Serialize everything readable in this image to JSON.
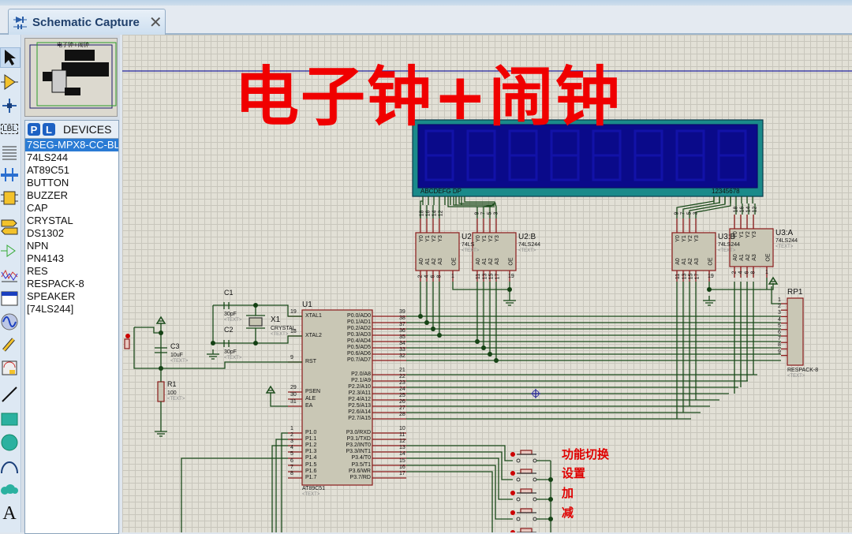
{
  "tab": {
    "label": "Schematic Capture",
    "close": "✕"
  },
  "toolbar": {
    "tools": [
      "selection-mode",
      "component-mode",
      "junction-dot-mode",
      "wire-label-mode",
      "text-script-mode",
      "buses-mode",
      "subcircuit-mode",
      "terminals-mode",
      "device-pins-mode",
      "graph-mode",
      "tape-recorder-mode",
      "generator-mode",
      "voltage-probe-mode",
      "virtual-instruments-mode",
      "line-mode",
      "box-mode",
      "circle-mode",
      "arc-mode",
      "path-mode",
      "text-mode"
    ],
    "label_tool_text": "LBL"
  },
  "devices": {
    "p_button": "P",
    "l_button": "L",
    "title": "DEVICES",
    "selected_index": 0,
    "items": [
      "7SEG-MPX8-CC-BLUE",
      "74LS244",
      "AT89C51",
      "BUTTON",
      "BUZZER",
      "CAP",
      "CRYSTAL",
      "DS1302",
      "NPN",
      "PN4143",
      "RES",
      "RESPACK-8",
      "SPEAKER",
      "[74LS244]"
    ]
  },
  "schematic": {
    "title_text": "电子钟+闹钟",
    "display": {
      "seg_pins": "ABCDEFG  DP",
      "digit_pins": "12345678",
      "digits": 8
    },
    "u1": {
      "ref": "U1",
      "part": "AT89C51",
      "text": "<TEXT>",
      "left_pins": [
        {
          "num": "19",
          "name": "XTAL1"
        },
        {
          "num": "18",
          "name": "XTAL2"
        },
        {
          "num": "9",
          "name": "RST"
        },
        {
          "num": "29",
          "name": "PSEN"
        },
        {
          "num": "30",
          "name": "ALE"
        },
        {
          "num": "31",
          "name": "EA"
        },
        {
          "num": "1",
          "name": "P1.0"
        },
        {
          "num": "2",
          "name": "P1.1"
        },
        {
          "num": "3",
          "name": "P1.2"
        },
        {
          "num": "4",
          "name": "P1.3"
        },
        {
          "num": "5",
          "name": "P1.4"
        },
        {
          "num": "6",
          "name": "P1.5"
        },
        {
          "num": "7",
          "name": "P1.6"
        },
        {
          "num": "8",
          "name": "P1.7"
        }
      ],
      "right_pins": [
        {
          "num": "39",
          "name": "P0.0/AD0"
        },
        {
          "num": "38",
          "name": "P0.1/AD1"
        },
        {
          "num": "37",
          "name": "P0.2/AD2"
        },
        {
          "num": "36",
          "name": "P0.3/AD3"
        },
        {
          "num": "35",
          "name": "P0.4/AD4"
        },
        {
          "num": "34",
          "name": "P0.5/AD5"
        },
        {
          "num": "33",
          "name": "P0.6/AD6"
        },
        {
          "num": "32",
          "name": "P0.7/AD7"
        },
        {
          "num": "21",
          "name": "P2.0/A8"
        },
        {
          "num": "22",
          "name": "P2.1/A9"
        },
        {
          "num": "23",
          "name": "P2.2/A10"
        },
        {
          "num": "24",
          "name": "P2.3/A11"
        },
        {
          "num": "25",
          "name": "P2.4/A12"
        },
        {
          "num": "26",
          "name": "P2.5/A13"
        },
        {
          "num": "27",
          "name": "P2.6/A14"
        },
        {
          "num": "28",
          "name": "P2.7/A15"
        },
        {
          "num": "10",
          "name": "P3.0/RXD"
        },
        {
          "num": "11",
          "name": "P3.1/TXD"
        },
        {
          "num": "12",
          "name": "P3.2/INT0"
        },
        {
          "num": "13",
          "name": "P3.3/INT1"
        },
        {
          "num": "14",
          "name": "P3.4/T0"
        },
        {
          "num": "15",
          "name": "P3.5/T1"
        },
        {
          "num": "16",
          "name": "P3.6/WR"
        },
        {
          "num": "17",
          "name": "P3.7/RD"
        }
      ]
    },
    "buffers": [
      {
        "ref": "U2",
        "part": "74LS",
        "y_pins": [
          "18",
          "16",
          "14",
          "12"
        ],
        "a_pins": [
          "2",
          "4",
          "6",
          "8"
        ],
        "oe": "1"
      },
      {
        "ref": "U2:B",
        "part": "74LS244",
        "y_pins": [
          "9",
          "7",
          "5",
          "3"
        ],
        "a_pins": [
          "11",
          "13",
          "15",
          "17"
        ],
        "oe": "19"
      },
      {
        "ref": "U3:B",
        "part": "74LS244",
        "y_pins": [
          "9",
          "7",
          "5",
          "3"
        ],
        "a_pins": [
          "11",
          "13",
          "15",
          "17"
        ],
        "oe": "19"
      },
      {
        "ref": "U3:A",
        "part": "74LS244",
        "y_pins": [
          "18",
          "16",
          "14",
          "12"
        ],
        "a_pins": [
          "2",
          "4",
          "6",
          "8"
        ],
        "oe": "1"
      }
    ],
    "pin_labels": {
      "y": [
        "Y0",
        "Y1",
        "Y2",
        "Y3"
      ],
      "a": [
        "A0",
        "A1",
        "A2",
        "A3"
      ],
      "oe": "OE"
    },
    "c1": {
      "ref": "C1",
      "value": "30pF",
      "text": "<TEXT>"
    },
    "c2": {
      "ref": "C2",
      "value": "30pF",
      "text": "<TEXT>"
    },
    "c3": {
      "ref": "C3",
      "value": "10uF",
      "text": "<TEXT>"
    },
    "r1": {
      "ref": "R1",
      "value": "100",
      "text": "<TEXT>"
    },
    "x1": {
      "ref": "X1",
      "value": "CRYSTAL",
      "text": "<TEXT>"
    },
    "rp1": {
      "ref": "RP1",
      "part": "RESPACK-8",
      "text": "<TEXT>",
      "pins": [
        "1",
        "2",
        "3",
        "4",
        "5",
        "6",
        "7",
        "8",
        "9"
      ]
    },
    "buttons": [
      "功能切换",
      "设置",
      "加",
      "减"
    ],
    "text_placeholder": "<TEXT>"
  }
}
